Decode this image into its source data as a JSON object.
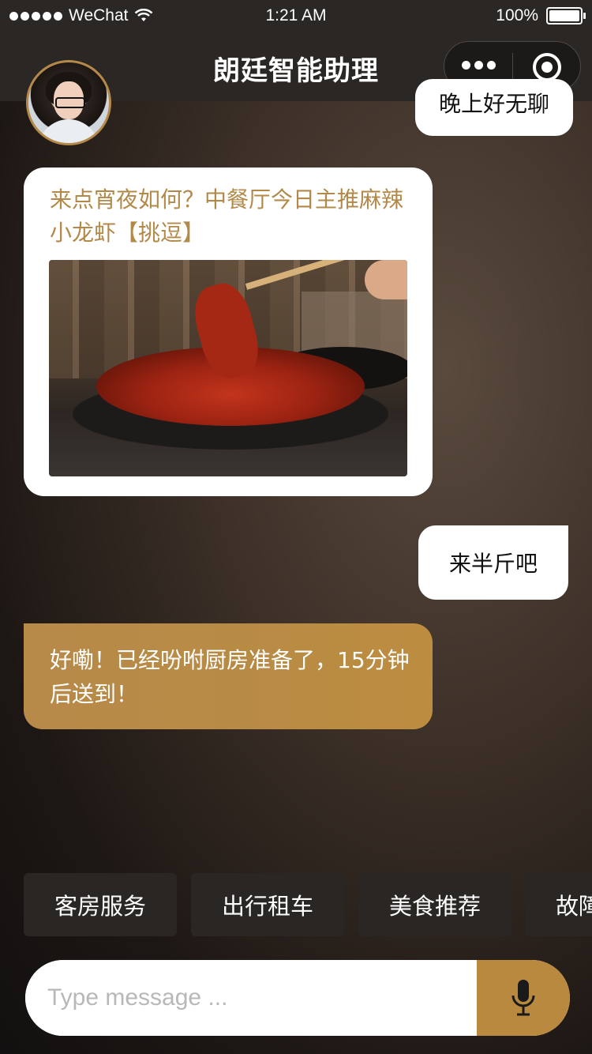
{
  "status_bar": {
    "carrier": "WeChat",
    "time": "1:21 AM",
    "battery": "100%"
  },
  "nav": {
    "title": "朗廷智能助理"
  },
  "messages": {
    "top_partial": "晚上好无聊",
    "card_text": "来点宵夜如何？中餐厅今日主推麻辣小龙虾【挑逗】",
    "user_reply": "来半斤吧",
    "bot_reply": "好嘞！已经吩咐厨房准备了，15分钟后送到！"
  },
  "quick_replies": [
    "客房服务",
    "出行租车",
    "美食推荐",
    "故障"
  ],
  "input": {
    "placeholder": "Type message ..."
  },
  "colors": {
    "accent": "#b8893f",
    "card_text": "#b3894a",
    "bar_bg": "#2a2725"
  },
  "icons": {
    "more": "more-dots-icon",
    "target": "record-target-icon",
    "mic": "microphone-icon",
    "wifi": "wifi-icon",
    "battery": "battery-icon"
  }
}
